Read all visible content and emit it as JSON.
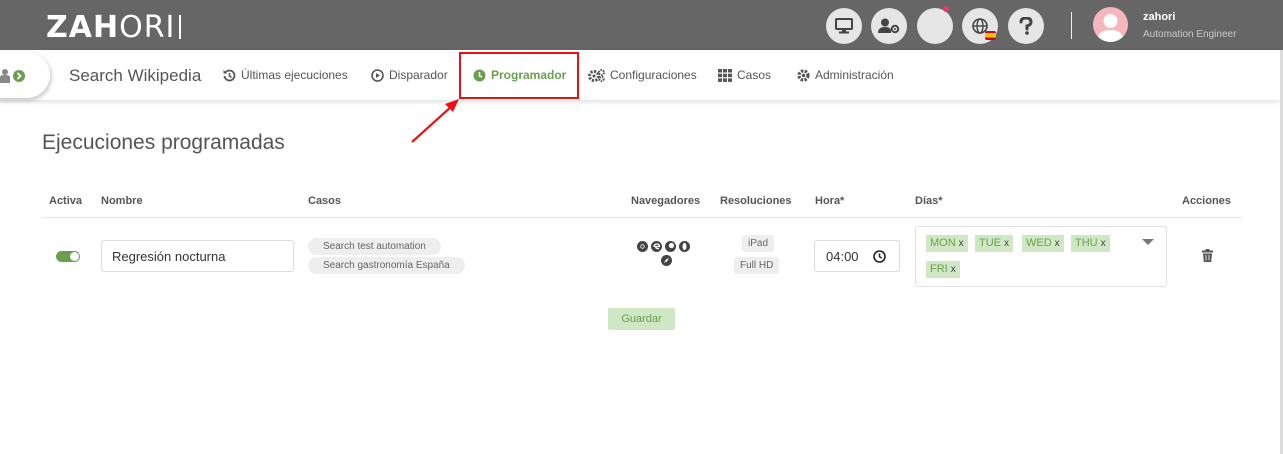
{
  "app": {
    "logo_bold": "ZAH",
    "logo_light": "ORI"
  },
  "header": {
    "icons": [
      "monitor-icon",
      "user-settings-icon",
      "notifications-icon",
      "language-icon",
      "help-icon"
    ],
    "user": {
      "name": "zahori",
      "role": "Automation Engineer"
    }
  },
  "project": {
    "title": "Search Wikipedia"
  },
  "nav": {
    "items": [
      {
        "label": "Últimas ejecuciones",
        "icon": "history-icon"
      },
      {
        "label": "Disparador",
        "icon": "play-circle-icon"
      },
      {
        "label": "Programador",
        "icon": "clock-icon",
        "active": true
      },
      {
        "label": "Configuraciones",
        "icon": "gears-icon"
      },
      {
        "label": "Casos",
        "icon": "grid-icon"
      },
      {
        "label": "Administración",
        "icon": "gear-icon"
      }
    ]
  },
  "page": {
    "heading": "Ejecuciones programadas"
  },
  "table": {
    "headers": {
      "active": "Activa",
      "name": "Nombre",
      "cases": "Casos",
      "browsers": "Navegadores",
      "resolutions": "Resoluciones",
      "time": "Hora*",
      "days": "Días*",
      "actions": "Acciones"
    },
    "rows": [
      {
        "active": true,
        "name": "Regresión nocturna",
        "cases": [
          "Search test automation",
          "Search gastronomía España"
        ],
        "browsers": [
          "chrome-icon",
          "edge-icon",
          "firefox-icon",
          "opera-icon",
          "safari-icon"
        ],
        "resolutions": [
          "iPad",
          "Full HD"
        ],
        "time": "04:00",
        "days": [
          "MON",
          "TUE",
          "WED",
          "THU",
          "FRI"
        ],
        "day_remove": "x"
      }
    ]
  },
  "actions": {
    "save_label": "Guardar"
  },
  "colors": {
    "accent": "#6aa04d",
    "accent_light": "#cfe7c5",
    "topbar": "#666666",
    "highlight": "#e11111"
  }
}
